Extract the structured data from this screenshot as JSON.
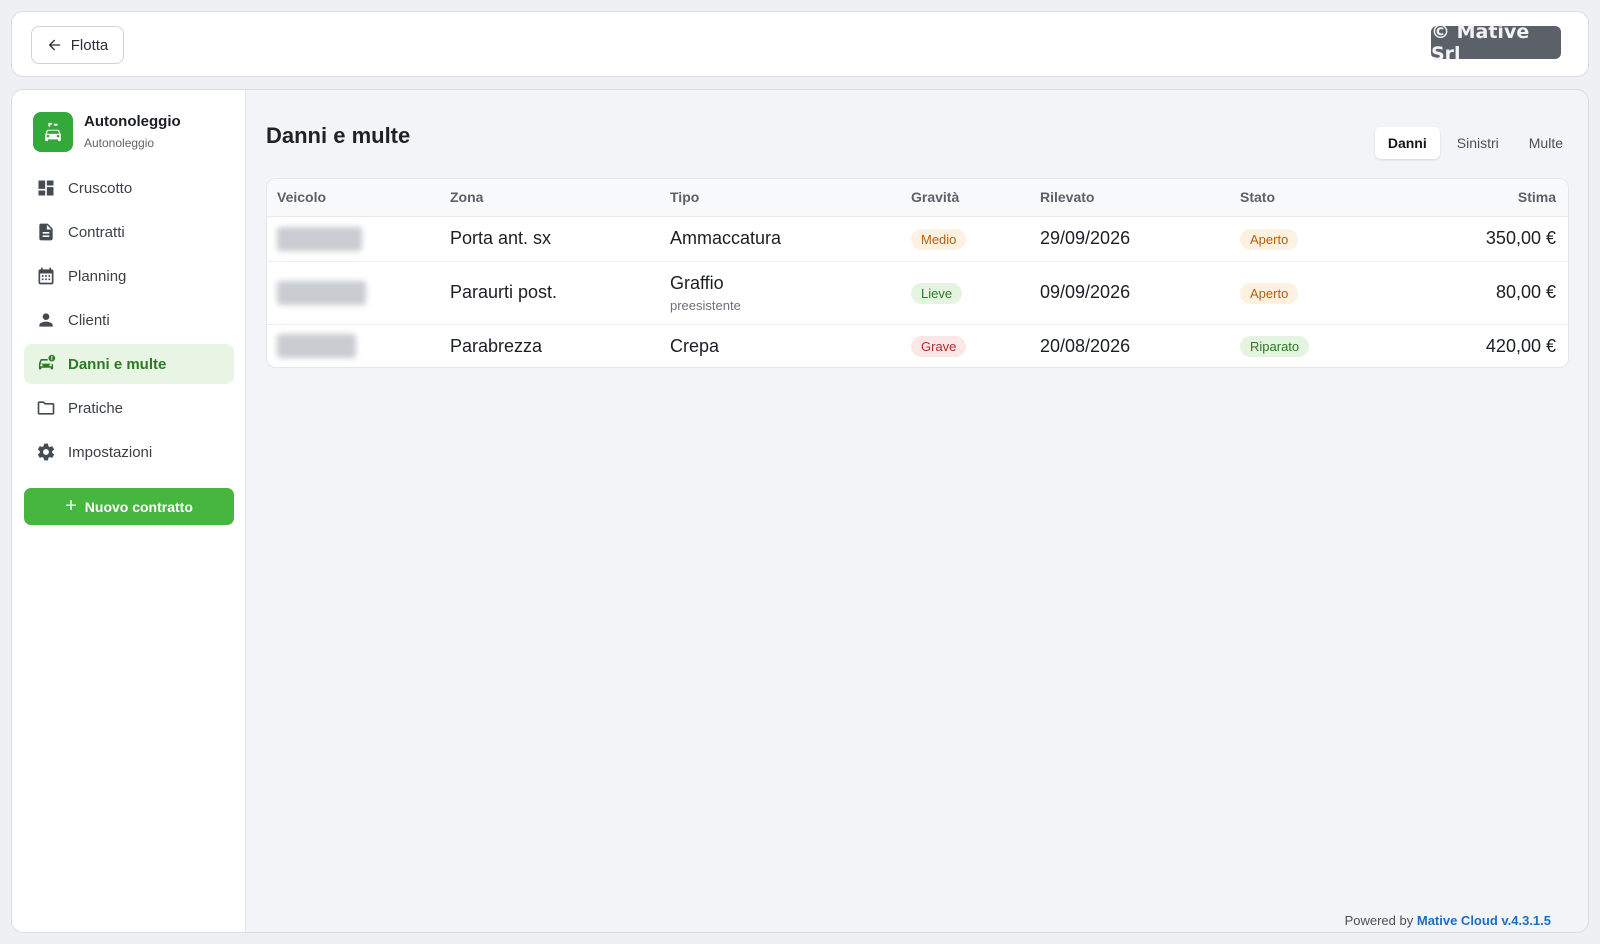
{
  "topbar": {
    "back_label": "Flotta",
    "brand": "© Mative Srl"
  },
  "sidebar": {
    "app_title": "Autonoleggio",
    "app_subtitle": "Autonoleggio",
    "items": [
      {
        "label": "Cruscotto",
        "icon": "dashboard-icon"
      },
      {
        "label": "Contratti",
        "icon": "document-icon"
      },
      {
        "label": "Planning",
        "icon": "calendar-icon"
      },
      {
        "label": "Clienti",
        "icon": "person-icon"
      },
      {
        "label": "Danni e multe",
        "icon": "car-damage-icon",
        "active": true
      },
      {
        "label": "Pratiche",
        "icon": "folder-icon"
      },
      {
        "label": "Impostazioni",
        "icon": "gear-icon"
      }
    ],
    "new_button": "Nuovo contratto"
  },
  "main": {
    "title": "Danni e multe",
    "tabs": [
      "Danni",
      "Sinistri",
      "Multe"
    ],
    "active_tab": "Danni",
    "columns": [
      "Veicolo",
      "Zona",
      "Tipo",
      "Gravità",
      "Rilevato",
      "Stato",
      "Stima"
    ],
    "rows": [
      {
        "zona": "Porta ant. sx",
        "tipo": "Ammaccatura",
        "tipo_sub": "",
        "gravita": "Medio",
        "gravita_color": "orange",
        "rilevato": "29/09/2026",
        "stato": "Aperto",
        "stato_color": "orange",
        "stima": "350,00 €"
      },
      {
        "zona": "Paraurti post.",
        "tipo": "Graffio",
        "tipo_sub": "preesistente",
        "gravita": "Lieve",
        "gravita_color": "green",
        "rilevato": "09/09/2026",
        "stato": "Aperto",
        "stato_color": "orange",
        "stima": "80,00 €"
      },
      {
        "zona": "Parabrezza",
        "tipo": "Crepa",
        "tipo_sub": "",
        "gravita": "Grave",
        "gravita_color": "red",
        "rilevato": "20/08/2026",
        "stato": "Riparato",
        "stato_color": "green",
        "stima": "420,00 €"
      }
    ]
  },
  "footer": {
    "prefix": "Powered by",
    "product": "Mative Cloud v.4.3.1.5"
  },
  "colors": {
    "accent": "#46b63e",
    "link": "#1a6fc4"
  }
}
